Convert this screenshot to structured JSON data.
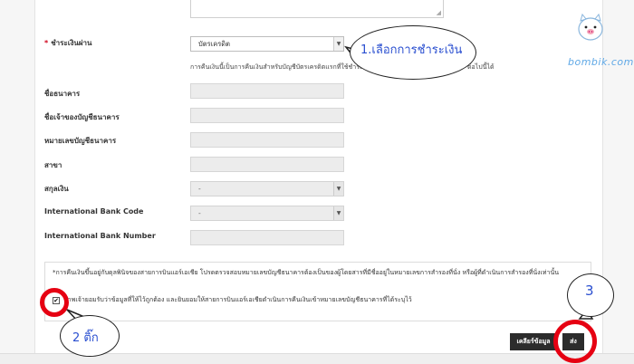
{
  "form": {
    "payment_method_label": "ชำระเงินผ่าน",
    "payment_method_value": "บัตรเครดิต",
    "refund_note": "การคืนเงินนี้เป็นการคืนเงินสำหรับบัญชีบัตรเครดิตแรกที่ใช้ชำระ",
    "refund_note_tail": "ต่อไปนี้ได้",
    "fields": {
      "bank_name": "ชื่อธนาคาร",
      "account_name": "ชื่อเจ้าของบัญชีธนาคาร",
      "account_number": "หมายเลขบัญชีธนาคาร",
      "branch": "สาขา",
      "currency": "สกุลเงิน",
      "currency_value": "-",
      "bank_code": "International Bank Code",
      "bank_code_value": "-",
      "bank_number": "International Bank Number"
    }
  },
  "disclaimer": {
    "text": "*การคืนเงินขึ้นอยู่กับดุลพินิจของสายการบินแอร์เอเชีย โปรดตรวจสอบหมายเลขบัญชีธนาคารต้องเป็นของผู้โดยสารที่มีชื่ออยู่ในหมายเลขการสำรองที่นั่ง หรือผู้ที่ดำเนินการสำรองที่นั่งเท่านั้น",
    "agree": "ข้าพเจ้ายอมรับว่าข้อมูลที่ให้ไว้ถูกต้อง และยินยอมให้สายการบินแอร์เอเชียดำเนินการคืนเงินเข้าหมายเลขบัญชีธนาคารที่ได้ระบุไว้",
    "checked": "✔"
  },
  "buttons": {
    "clear": "เคลียร์ข้อมูล",
    "submit": "ส่ง"
  },
  "annotations": {
    "step1": "1.เลือกการชำระเงิน",
    "step2": "2 ติ๊ก",
    "step3": "3"
  },
  "watermark": "bombik.com",
  "colors": {
    "highlight_circle": "#e60012",
    "annotation_text": "#2a4fd0",
    "button_bg": "#2c2c2c"
  }
}
